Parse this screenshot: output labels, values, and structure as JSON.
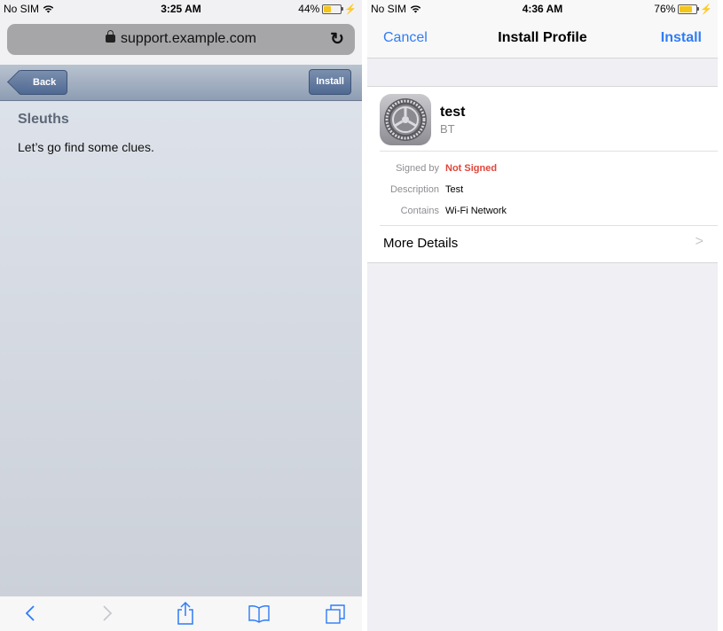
{
  "left": {
    "status": {
      "carrier": "No SIM",
      "time": "3:25 AM",
      "battery": "44%",
      "battery_level": 0.44
    },
    "url": "support.example.com",
    "nav": {
      "back_label": "Back",
      "install_label": "Install"
    },
    "content": {
      "heading": "Sleuths",
      "body": "Let’s go find some clues."
    },
    "toolbar": {
      "icons": [
        "back-icon",
        "forward-icon",
        "share-icon",
        "bookmarks-icon",
        "tabs-icon"
      ]
    }
  },
  "right": {
    "status": {
      "carrier": "No SIM",
      "time": "4:36 AM",
      "battery": "76%",
      "battery_level": 0.76
    },
    "nav": {
      "cancel_label": "Cancel",
      "title": "Install Profile",
      "install_label": "Install"
    },
    "profile": {
      "name": "test",
      "organization": "BT",
      "rows": [
        {
          "label": "Signed by",
          "value": "Not Signed"
        },
        {
          "label": "Description",
          "value": "Test"
        },
        {
          "label": "Contains",
          "value": "Wi-Fi Network"
        }
      ],
      "more_details": "More Details"
    }
  },
  "colors": {
    "accent": "#2f7cf6",
    "warning": "#e0453a"
  }
}
